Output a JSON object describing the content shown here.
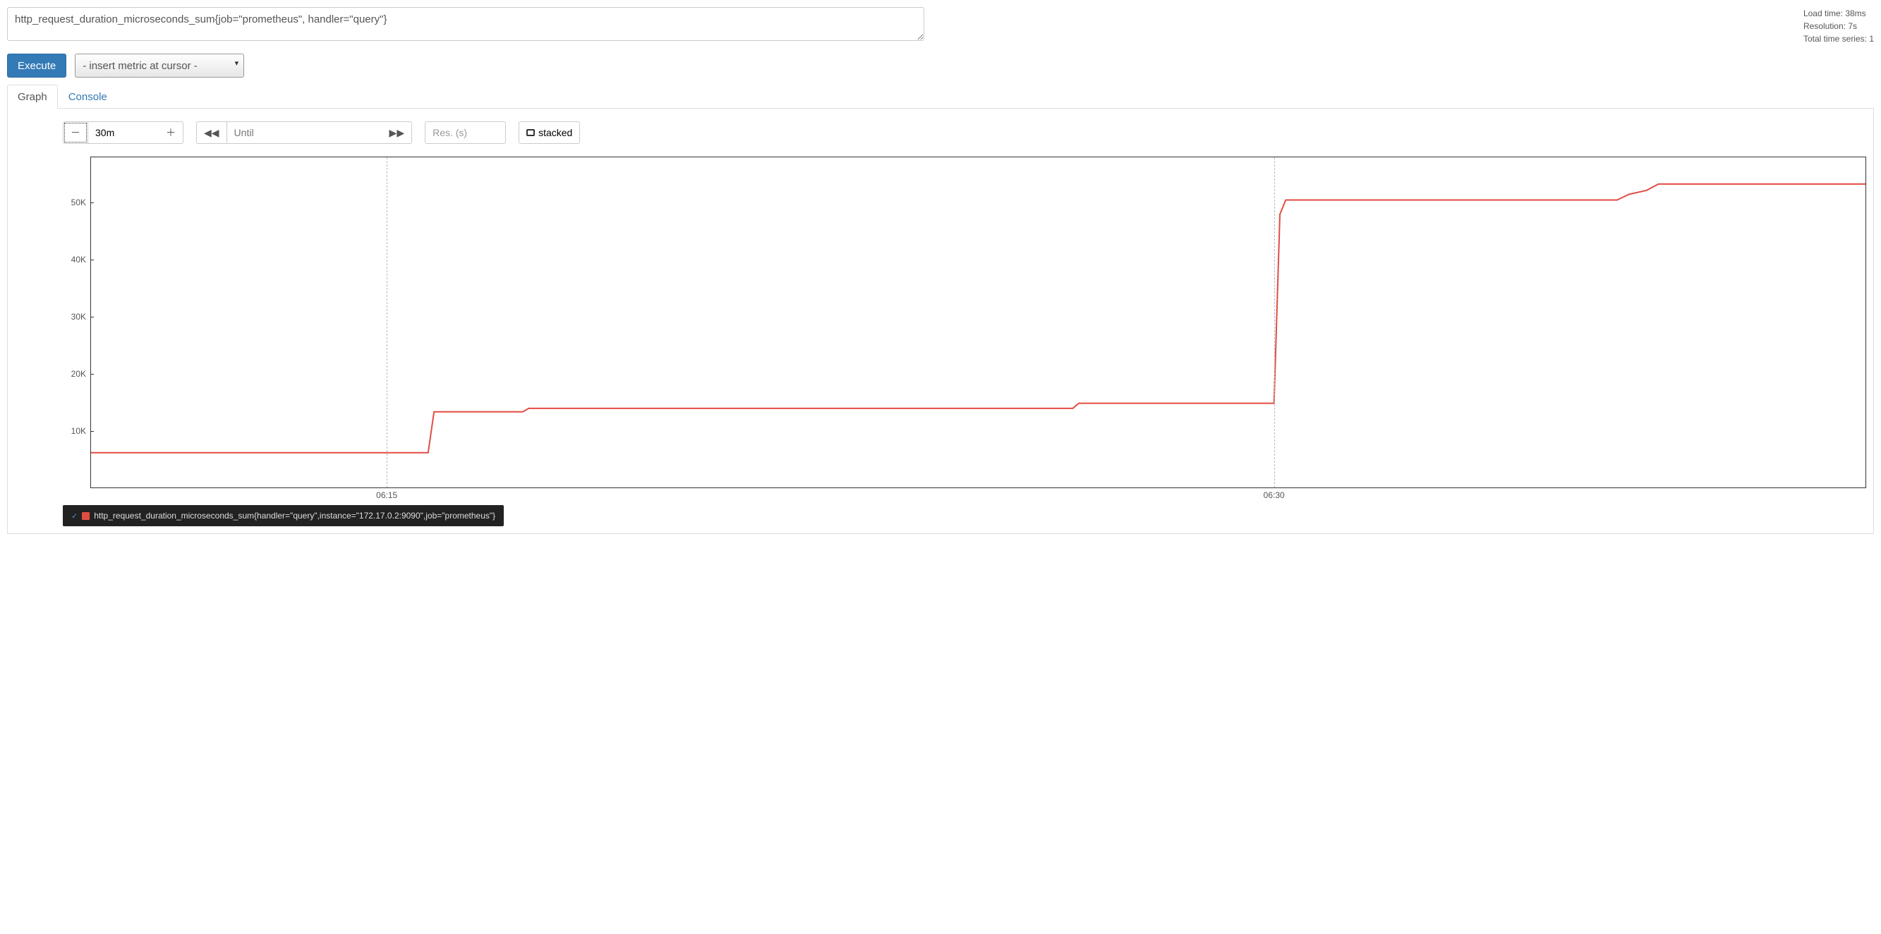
{
  "query": {
    "expression": "http_request_duration_microseconds_sum{job=\"prometheus\", handler=\"query\"}"
  },
  "stats": {
    "load_time_label": "Load time: 38ms",
    "resolution_label": "Resolution: 7s",
    "total_series_label": "Total time series: 1"
  },
  "buttons": {
    "execute": "Execute",
    "metric_placeholder": "- insert metric at cursor -",
    "minus": "➖",
    "plus": "➕",
    "rewind": "◀◀",
    "forward": "▶▶",
    "stacked": "stacked"
  },
  "tabs": {
    "graph": "Graph",
    "console": "Console"
  },
  "range": {
    "value": "30m",
    "until_placeholder": "Until",
    "res_placeholder": "Res. (s)"
  },
  "legend": {
    "series_label": "http_request_duration_microseconds_sum{handler=\"query\",instance=\"172.17.0.2:9090\",job=\"prometheus\"}",
    "swatch_color": "#e24d42"
  },
  "chart_data": {
    "type": "line",
    "xlabel": "",
    "ylabel": "",
    "ylim": [
      0,
      58000
    ],
    "y_ticks": [
      10000,
      20000,
      30000,
      40000,
      50000
    ],
    "y_tick_labels": [
      "10K",
      "20K",
      "30K",
      "40K",
      "50K"
    ],
    "x_range_minutes": [
      0,
      30
    ],
    "x_ticks_minutes": [
      5,
      20
    ],
    "x_tick_labels": [
      "06:15",
      "06:30"
    ],
    "series": [
      {
        "name": "http_request_duration_microseconds_sum{handler=\"query\",instance=\"172.17.0.2:9090\",job=\"prometheus\"}",
        "color": "#e24d42",
        "x_minutes": [
          0,
          5.7,
          5.8,
          7.3,
          7.4,
          16.6,
          16.7,
          20.0,
          20.1,
          20.2,
          25.8,
          26.0,
          26.3,
          26.5,
          30
        ],
        "y": [
          6100,
          6100,
          13300,
          13300,
          13900,
          13900,
          14800,
          14800,
          48000,
          50500,
          50500,
          51500,
          52200,
          53300,
          53300
        ]
      }
    ]
  }
}
